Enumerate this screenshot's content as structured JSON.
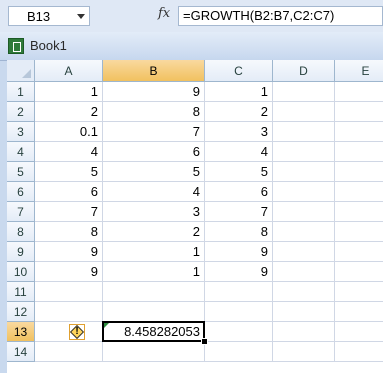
{
  "formula_bar": {
    "name_box": "B13",
    "fx_label": "fx",
    "formula": "=GROWTH(B2:B7,C2:C7)"
  },
  "workbook": {
    "title": "Book1"
  },
  "columns": [
    "A",
    "B",
    "C",
    "D",
    "E"
  ],
  "rows": [
    "1",
    "2",
    "3",
    "4",
    "5",
    "6",
    "7",
    "8",
    "9",
    "10",
    "11",
    "12",
    "13",
    "14"
  ],
  "cells": {
    "A": [
      "1",
      "2",
      "0.1",
      "4",
      "5",
      "6",
      "7",
      "8",
      "9",
      "9",
      "",
      "",
      "",
      ""
    ],
    "B": [
      "9",
      "8",
      "7",
      "6",
      "5",
      "4",
      "3",
      "2",
      "1",
      "1",
      "",
      "",
      "8.458282053",
      ""
    ],
    "C": [
      "1",
      "2",
      "3",
      "4",
      "5",
      "6",
      "7",
      "8",
      "9",
      "9",
      "",
      "",
      "",
      ""
    ]
  },
  "selected_cell": "B13",
  "colors": {
    "selection_header": "#f1c15f",
    "grid_line": "#d0d7e5"
  },
  "icons": {
    "error_indicator": "warning-icon",
    "app": "excel-icon"
  }
}
